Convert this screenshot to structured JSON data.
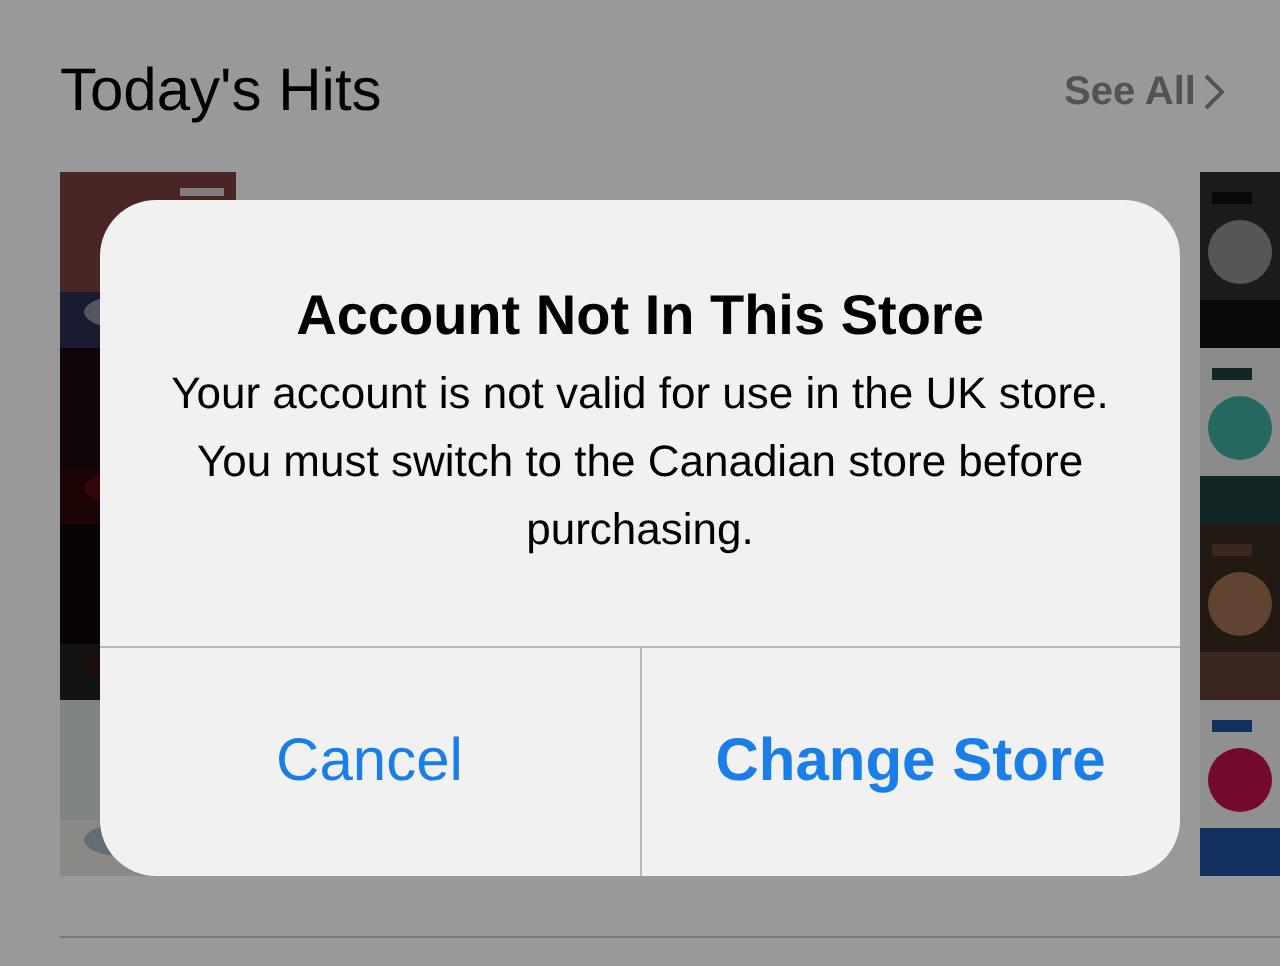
{
  "section": {
    "title": "Today's Hits",
    "see_all": "See All"
  },
  "alert": {
    "title": "Account Not In This Store",
    "message": "Your account is not valid for use in the UK store. You must switch to the Canadian store before purchasing.",
    "buttons": [
      {
        "label": "Cancel",
        "kind": "cancel"
      },
      {
        "label": "Change Store",
        "kind": "default"
      }
    ]
  }
}
